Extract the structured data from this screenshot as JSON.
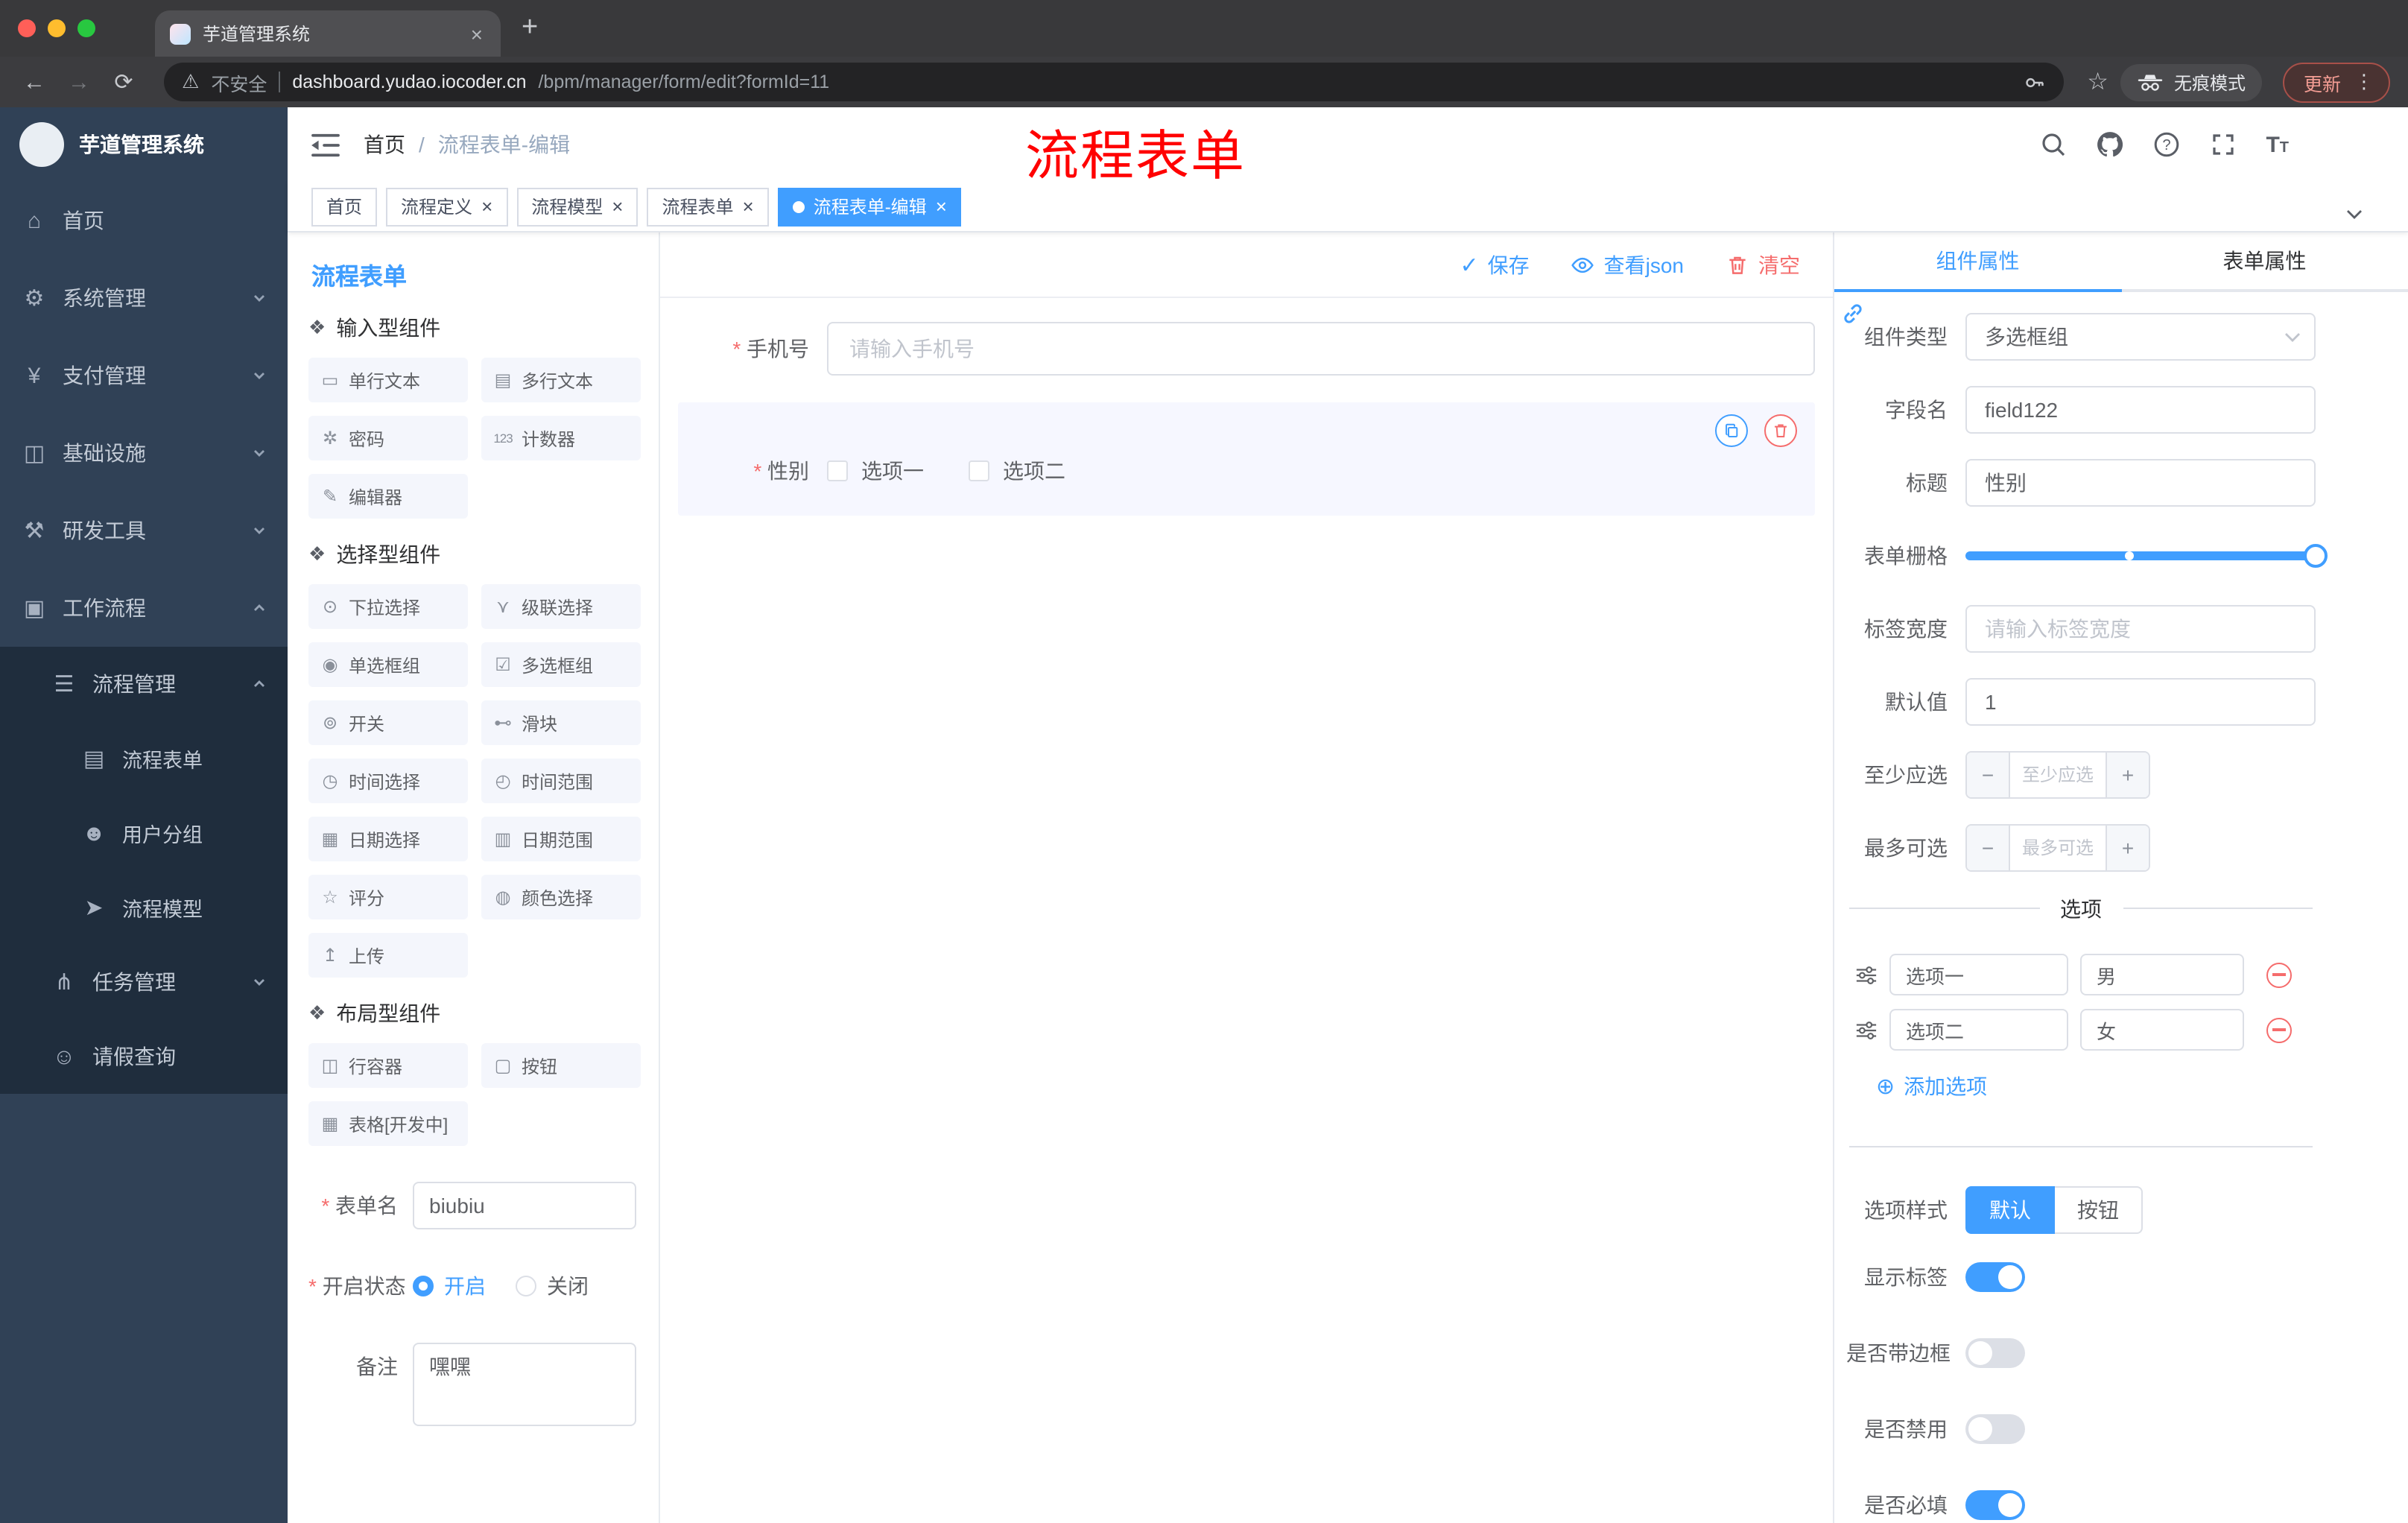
{
  "annotation": {
    "text": "流程表单"
  },
  "browser": {
    "tab_title": "芋道管理系统",
    "security": "不安全",
    "url_host": "dashboard.yudao.iocoder.cn",
    "url_path": "/bpm/manager/form/edit?formId=11",
    "incognito": "无痕模式",
    "update": "更新"
  },
  "sidebar": {
    "logo": "芋道管理系统",
    "items": [
      {
        "label": "首页",
        "glyph": "⌂"
      },
      {
        "label": "系统管理",
        "glyph": "⚙"
      },
      {
        "label": "支付管理",
        "glyph": "¥"
      },
      {
        "label": "基础设施",
        "glyph": "◫"
      },
      {
        "label": "研发工具",
        "glyph": "⚒"
      },
      {
        "label": "工作流程",
        "glyph": "▣"
      }
    ],
    "workflow_children": [
      {
        "label": "流程管理",
        "glyph": "☰"
      }
    ],
    "process_children": [
      {
        "label": "流程表单",
        "glyph": "▤"
      },
      {
        "label": "用户分组",
        "glyph": "☻"
      },
      {
        "label": "流程模型",
        "glyph": "➤"
      }
    ],
    "workflow_tail": [
      {
        "label": "任务管理",
        "glyph": "⋔"
      },
      {
        "label": "请假查询",
        "glyph": "☺"
      }
    ]
  },
  "header": {
    "breadcrumb_home": "首页",
    "breadcrumb_current": "流程表单-编辑"
  },
  "tags": [
    {
      "label": "首页"
    },
    {
      "label": "流程定义"
    },
    {
      "label": "流程模型"
    },
    {
      "label": "流程表单"
    },
    {
      "label": "流程表单-编辑"
    }
  ],
  "palette": {
    "title": "流程表单",
    "groups": [
      {
        "title": "输入型组件",
        "glyph": "❖",
        "items": [
          {
            "label": "单行文本",
            "glyph": "▭"
          },
          {
            "label": "多行文本",
            "glyph": "▤"
          },
          {
            "label": "密码",
            "glyph": "✲"
          },
          {
            "label": "计数器",
            "glyph": "123"
          },
          {
            "label": "编辑器",
            "glyph": "✎"
          }
        ]
      },
      {
        "title": "选择型组件",
        "glyph": "❖",
        "items": [
          {
            "label": "下拉选择",
            "glyph": "⊙"
          },
          {
            "label": "级联选择",
            "glyph": "⋎"
          },
          {
            "label": "单选框组",
            "glyph": "◉"
          },
          {
            "label": "多选框组",
            "glyph": "☑"
          },
          {
            "label": "开关",
            "glyph": "⊚"
          },
          {
            "label": "滑块",
            "glyph": "⊷"
          },
          {
            "label": "时间选择",
            "glyph": "◷"
          },
          {
            "label": "时间范围",
            "glyph": "◴"
          },
          {
            "label": "日期选择",
            "glyph": "▦"
          },
          {
            "label": "日期范围",
            "glyph": "▥"
          },
          {
            "label": "评分",
            "glyph": "☆"
          },
          {
            "label": "颜色选择",
            "glyph": "◍"
          },
          {
            "label": "上传",
            "glyph": "↥"
          }
        ]
      },
      {
        "title": "布局型组件",
        "glyph": "❖",
        "items": [
          {
            "label": "行容器",
            "glyph": "◫"
          },
          {
            "label": "按钮",
            "glyph": "▢"
          },
          {
            "label": "表格[开发中]",
            "glyph": "▦"
          }
        ]
      }
    ],
    "form": {
      "name_label": "表单名",
      "name_value": "biubiu",
      "status_label": "开启状态",
      "status_on": "开启",
      "status_off": "关闭",
      "remark_label": "备注",
      "remark_value": "嘿嘿"
    }
  },
  "canvas": {
    "toolbar": {
      "save": "保存",
      "view_json": "查看json",
      "clear": "清空"
    },
    "phone": {
      "label": "手机号",
      "placeholder": "请输入手机号"
    },
    "gender": {
      "label": "性别",
      "option1": "选项一",
      "option2": "选项二"
    }
  },
  "inspector": {
    "tab_component": "组件属性",
    "tab_form": "表单属性",
    "rows": {
      "type_label": "组件类型",
      "type_value": "多选框组",
      "field_label": "字段名",
      "field_value": "field122",
      "title_label": "标题",
      "title_value": "性别",
      "grid_label": "表单栅格",
      "width_label": "标签宽度",
      "width_placeholder": "请输入标签宽度",
      "default_label": "默认值",
      "default_value": "1",
      "min_label": "至少应选",
      "min_placeholder": "至少应选",
      "max_label": "最多可选",
      "max_placeholder": "最多可选"
    },
    "options_section": {
      "title": "选项",
      "options": [
        {
          "label": "选项一",
          "value": "男"
        },
        {
          "label": "选项二",
          "value": "女"
        }
      ],
      "add_label": "添加选项"
    },
    "style_row": {
      "label": "选项样式",
      "choice_default": "默认",
      "choice_button": "按钮"
    },
    "switches": [
      {
        "label": "显示标签"
      },
      {
        "label": "是否带边框"
      },
      {
        "label": "是否禁用"
      },
      {
        "label": "是否必填"
      }
    ]
  }
}
